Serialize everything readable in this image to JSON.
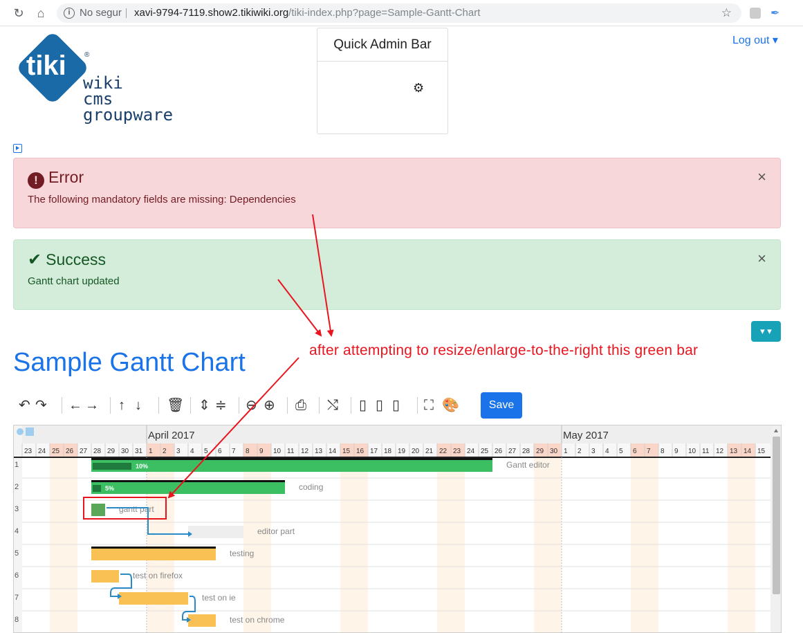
{
  "browser": {
    "security_label": "No segur",
    "url_host": "xavi-9794-7119.show2.tikiwiki.org",
    "url_path": "/tiki-index.php?page=Sample-Gantt-Chart"
  },
  "logo": {
    "line1": "wiki",
    "line2": "cms",
    "line3": "groupware",
    "brand": "tiki"
  },
  "quick_admin": {
    "title": "Quick Admin Bar",
    "gear_icon": "gear-icon"
  },
  "header": {
    "logout_label": "Log out"
  },
  "alerts": {
    "error": {
      "title": "Error",
      "body": "The following mandatory fields are missing: Dependencies",
      "close": "×"
    },
    "success": {
      "title": "Success",
      "body": "Gantt chart updated",
      "close": "×"
    }
  },
  "page": {
    "title": "Sample Gantt Chart"
  },
  "annotation": {
    "text": "after attempting to resize/enlarge-to-the-right this green bar"
  },
  "toolbar": {
    "icons": [
      "undo-icon",
      "redo-icon",
      "outdent-icon",
      "indent-icon",
      "move-up-icon",
      "move-down-icon",
      "delete-icon",
      "expand-all-icon",
      "collapse-all-icon",
      "zoom-out-icon",
      "zoom-in-icon",
      "print-icon",
      "critical-path-icon",
      "split-left-icon",
      "split-middle-icon",
      "split-right-icon",
      "fullscreen-icon",
      "palette-icon"
    ],
    "save_label": "Save"
  },
  "gantt": {
    "months": [
      "April 2017",
      "May 2017"
    ],
    "days": [
      "23",
      "24",
      "25",
      "26",
      "27",
      "28",
      "29",
      "30",
      "31",
      "1",
      "2",
      "3",
      "4",
      "5",
      "6",
      "7",
      "8",
      "9",
      "10",
      "11",
      "12",
      "13",
      "14",
      "15",
      "16",
      "17",
      "18",
      "19",
      "20",
      "21",
      "22",
      "23",
      "24",
      "25",
      "26",
      "27",
      "28",
      "29",
      "30",
      "1",
      "2",
      "3",
      "4",
      "5",
      "6",
      "7",
      "8",
      "9",
      "10",
      "11",
      "12",
      "13",
      "14",
      "15"
    ],
    "weekend_indices": [
      2,
      3,
      9,
      10,
      16,
      17,
      23,
      24,
      30,
      31,
      37,
      38,
      44,
      45,
      51,
      52
    ],
    "row_numbers": [
      "1",
      "2",
      "3",
      "4",
      "5",
      "6",
      "7",
      "8"
    ],
    "tasks": [
      {
        "name": "Gantt editor",
        "start": 5,
        "duration": 29,
        "progress": "10%",
        "color": "#3cbf63",
        "group": true
      },
      {
        "name": "coding",
        "start": 5,
        "duration": 14,
        "progress": "5%",
        "color": "#3cbf63",
        "group": true
      },
      {
        "name": "gantt part",
        "start": 5,
        "duration": 1,
        "progress": "",
        "color": "#5aa75a",
        "group": false
      },
      {
        "name": "editor part",
        "start": 12,
        "duration": 4,
        "progress": "",
        "color": "#eeeeee",
        "group": false
      },
      {
        "name": "testing",
        "start": 5,
        "duration": 9,
        "progress": "",
        "color": "#f9c154",
        "group": true
      },
      {
        "name": "test on firefox",
        "start": 5,
        "duration": 2,
        "progress": "",
        "color": "#f9c154",
        "group": false
      },
      {
        "name": "test on ie",
        "start": 7,
        "duration": 5,
        "progress": "",
        "color": "#f9c154",
        "group": false
      },
      {
        "name": "test on chrome",
        "start": 12,
        "duration": 2,
        "progress": "",
        "color": "#f9c154",
        "group": false
      }
    ]
  },
  "colors": {
    "link": "#1a73e8",
    "annotation": "#e8151f",
    "weekend": "#f9d6c8"
  }
}
